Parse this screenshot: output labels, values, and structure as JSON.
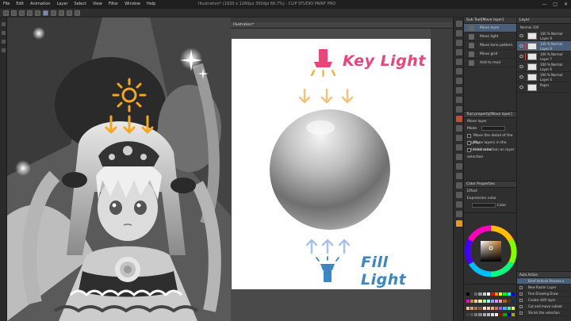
{
  "window": {
    "title": "Illustration* (1920 x 1260px 350dpi 66.7%) - CLIP STUDIO PAINT PRO",
    "controls": [
      "—",
      "□",
      "✕"
    ]
  },
  "menu": [
    "File",
    "Edit",
    "Animation",
    "Layer",
    "Select",
    "View",
    "Filter",
    "Window",
    "Help"
  ],
  "canvas": {
    "tab_label": "Illustration*",
    "key_light_label": "Key Light",
    "fill_light_label": "Fill Light",
    "colors": {
      "key": "#e8457a",
      "fill": "#3d86c4",
      "key_arrows": "#f6c27a",
      "fill_arrows": "#a9c3e8",
      "sun": "#f5a623"
    }
  },
  "subtool_panel": {
    "header": "Sub Tool[Move layer]",
    "items": [
      "Move layer",
      "Move light",
      "Move tone pattern",
      "Move grid",
      "Add to mod"
    ]
  },
  "tool_property": {
    "header": "Tool property[Move layer]",
    "section": "Move layer",
    "mode_label": "Mode",
    "checks": [
      "Move the detail of the display",
      "Move layers in the selected area",
      "Hold selection on layer selection"
    ]
  },
  "brush_size": {
    "header": "Color Properties",
    "effect_label": "Effect",
    "expression_label": "Expression color",
    "expression_value": "Color"
  },
  "layer_panel": {
    "header": "Layer",
    "blend": "Normal",
    "opacity": "100",
    "layers": [
      {
        "name": "100 % Normal Layer 9",
        "selected": false
      },
      {
        "name": "100 % Normal Layer 8",
        "selected": true
      },
      {
        "name": "100 % Normal Layer 7",
        "selected": false
      },
      {
        "name": "100 % Normal Layer 6",
        "selected": false
      },
      {
        "name": "100 % Normal Layer 4",
        "selected": false
      },
      {
        "name": "Paper",
        "selected": false
      }
    ]
  },
  "auto_actions": {
    "header": "Auto Action",
    "set_label": "Brief Actions Process ▾",
    "items": [
      "New Raster Layer",
      "Fine Drawing Draw",
      "Create shift layer",
      "Cut and move subset",
      "Shrink the selection"
    ]
  },
  "color_wheel": {
    "current_color": "#c89a6a"
  }
}
